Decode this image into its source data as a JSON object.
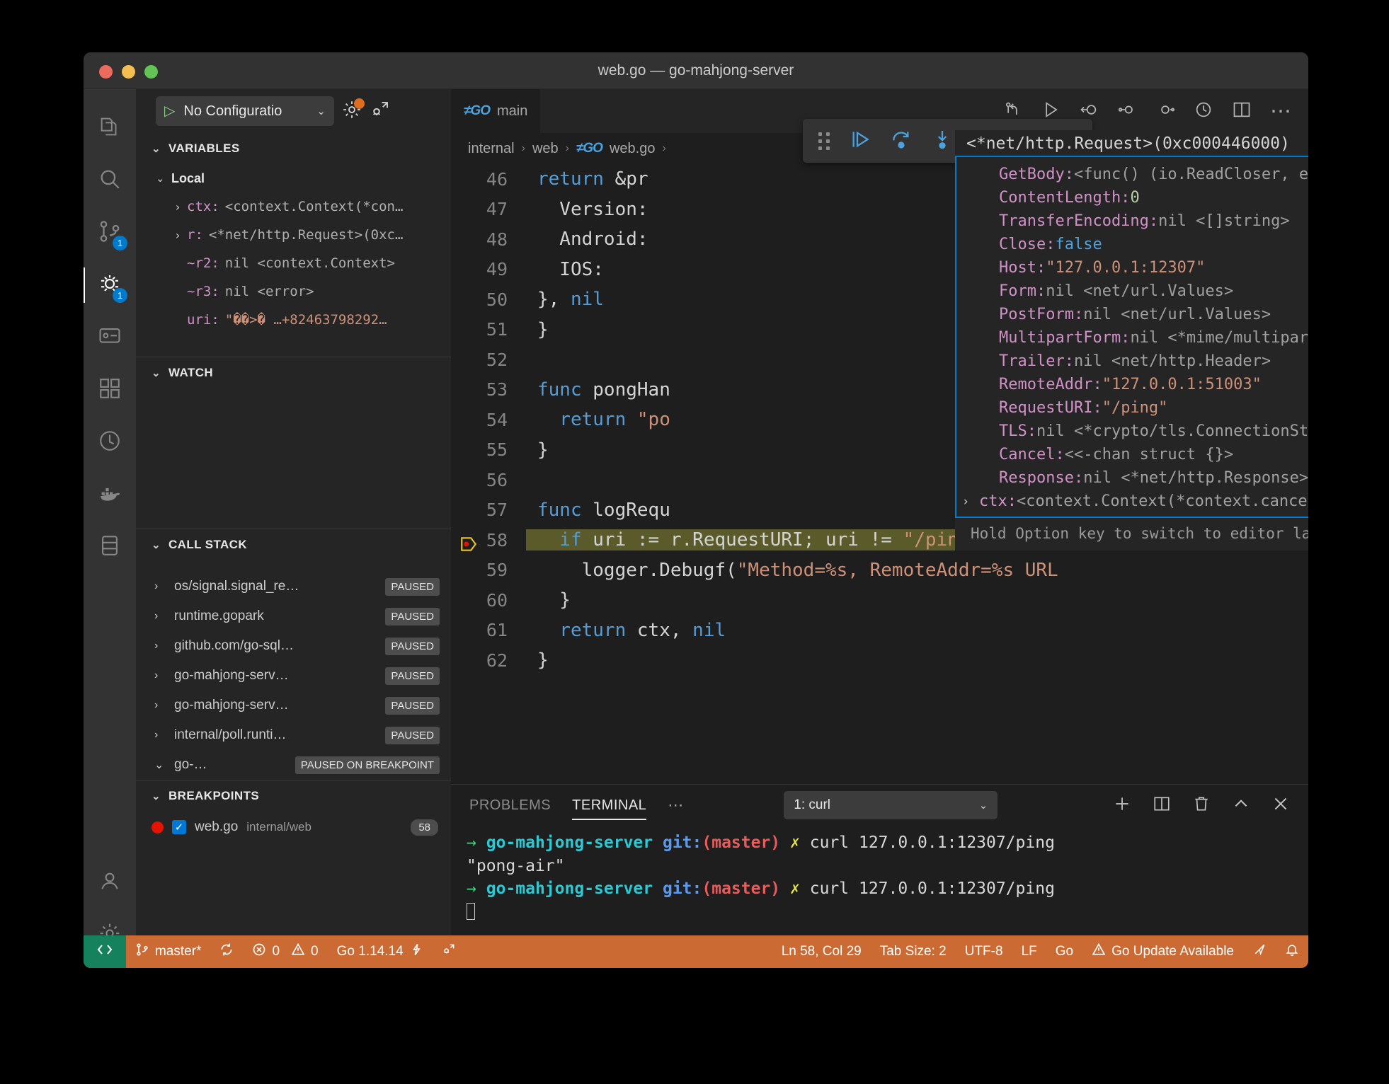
{
  "window": {
    "title": "web.go — go-mahjong-server"
  },
  "activity_bar": {
    "items": [
      {
        "name": "explorer",
        "icon": "files-icon",
        "badge": null
      },
      {
        "name": "search",
        "icon": "search-icon",
        "badge": null
      },
      {
        "name": "source-control",
        "icon": "source-control-icon",
        "badge": "1"
      },
      {
        "name": "run-and-debug",
        "icon": "debug-icon",
        "badge": "1",
        "active": true
      },
      {
        "name": "remote-explorer",
        "icon": "remote-explorer-icon",
        "badge": null
      },
      {
        "name": "extensions",
        "icon": "extensions-icon",
        "badge": null
      },
      {
        "name": "testing",
        "icon": "beaker-icon",
        "badge": null
      },
      {
        "name": "docker",
        "icon": "docker-icon",
        "badge": null
      },
      {
        "name": "database",
        "icon": "database-icon",
        "badge": null
      }
    ],
    "bottom": [
      {
        "name": "accounts",
        "icon": "account-icon"
      },
      {
        "name": "settings",
        "icon": "gear-icon"
      }
    ]
  },
  "debug_sidebar": {
    "config_label": "No Configuratio",
    "config_play_icon": "play-icon",
    "gear_icon": "gear-icon",
    "open_debug_console_icon": "debug-console-icon",
    "variables": {
      "title": "VARIABLES",
      "scope": "Local",
      "rows": [
        {
          "expandable": true,
          "name": "ctx:",
          "value": "<context.Context(*con…"
        },
        {
          "expandable": true,
          "name": "r:",
          "value": "<*net/http.Request>(0xc…"
        },
        {
          "expandable": false,
          "name": "~r2:",
          "value": "nil <context.Context>"
        },
        {
          "expandable": false,
          "name": "~r3:",
          "value": "nil <error>"
        },
        {
          "expandable": false,
          "name": "uri:",
          "value": "\"��>� …+82463798292…",
          "is_string": true
        }
      ]
    },
    "watch": {
      "title": "WATCH"
    },
    "call_stack": {
      "title": "CALL STACK",
      "rows": [
        {
          "name": "os/signal.signal_re…",
          "state": "PAUSED"
        },
        {
          "name": "runtime.gopark",
          "state": "PAUSED"
        },
        {
          "name": "github.com/go-sql…",
          "state": "PAUSED"
        },
        {
          "name": "go-mahjong-serv…",
          "state": "PAUSED"
        },
        {
          "name": "go-mahjong-serv…",
          "state": "PAUSED"
        },
        {
          "name": "internal/poll.runti…",
          "state": "PAUSED"
        },
        {
          "name": "go-…",
          "state": "PAUSED ON BREAKPOINT",
          "expanded": true
        }
      ]
    },
    "breakpoints": {
      "title": "BREAKPOINTS",
      "rows": [
        {
          "file": "web.go",
          "path": "internal/web",
          "line": "58",
          "enabled": true
        }
      ]
    }
  },
  "debug_toolbar": {
    "buttons": [
      {
        "name": "drag-handle",
        "icon": "grip-icon"
      },
      {
        "name": "continue-button",
        "icon": "continue-icon"
      },
      {
        "name": "step-over-button",
        "icon": "step-over-icon"
      },
      {
        "name": "step-into-button",
        "icon": "step-into-icon"
      },
      {
        "name": "step-out-button",
        "icon": "step-out-icon"
      },
      {
        "name": "restart-button",
        "icon": "restart-icon"
      },
      {
        "name": "stop-button",
        "icon": "stop-icon"
      }
    ]
  },
  "editor": {
    "tab": {
      "label": "main",
      "icon": "go-file-icon"
    },
    "actions": [
      {
        "name": "split-editor-down-button",
        "icon": "split-down-icon"
      },
      {
        "name": "run-go-button",
        "icon": "run-icon"
      },
      {
        "name": "debug-test-button",
        "icon": "debug-alt-icon"
      },
      {
        "name": "run-subtest-button",
        "icon": "run-subtest-icon"
      },
      {
        "name": "run-file-button",
        "icon": "run-file-icon"
      },
      {
        "name": "go-test-coverage-button",
        "icon": "coverage-icon"
      },
      {
        "name": "split-editor-right-button",
        "icon": "split-right-icon"
      },
      {
        "name": "more-actions-button",
        "icon": "ellipsis-icon"
      }
    ],
    "breadcrumb": [
      "internal",
      "web",
      "web.go"
    ],
    "breadcrumb_file_icon": "go-file-icon",
    "lines": [
      {
        "n": "46",
        "tokens": [
          {
            "t": "return ",
            "c": "k"
          },
          {
            "t": "&pr",
            "c": "id"
          }
        ]
      },
      {
        "n": "47",
        "tokens": [
          {
            "t": "  Version:",
            "c": "id"
          }
        ]
      },
      {
        "n": "48",
        "tokens": [
          {
            "t": "  Android:",
            "c": "id"
          }
        ]
      },
      {
        "n": "49",
        "tokens": [
          {
            "t": "  IOS:",
            "c": "id"
          }
        ]
      },
      {
        "n": "50",
        "tokens": [
          {
            "t": "}, ",
            "c": "id"
          },
          {
            "t": "nil",
            "c": "k"
          }
        ]
      },
      {
        "n": "51",
        "tokens": [
          {
            "t": "}",
            "c": "id"
          }
        ]
      },
      {
        "n": "52",
        "tokens": []
      },
      {
        "n": "53",
        "tokens": [
          {
            "t": "func ",
            "c": "k"
          },
          {
            "t": "pongHan",
            "c": "id"
          }
        ]
      },
      {
        "n": "54",
        "tokens": [
          {
            "t": "  return ",
            "c": "k"
          },
          {
            "t": "\"po",
            "c": "s"
          }
        ]
      },
      {
        "n": "55",
        "tokens": [
          {
            "t": "}",
            "c": "id"
          }
        ]
      },
      {
        "n": "56",
        "tokens": []
      },
      {
        "n": "57",
        "tokens": [
          {
            "t": "func ",
            "c": "k"
          },
          {
            "t": "logRequ",
            "c": "id"
          }
        ]
      },
      {
        "n": "58",
        "highlight": true,
        "breakpoint": true,
        "tokens": [
          {
            "t": "  if ",
            "c": "k"
          },
          {
            "t": "uri := r.RequestURI; uri != ",
            "c": "id"
          },
          {
            "t": "\"/ping\"",
            "c": "s"
          },
          {
            "t": " {",
            "c": "id"
          }
        ]
      },
      {
        "n": "59",
        "tokens": [
          {
            "t": "    logger.Debugf(",
            "c": "id"
          },
          {
            "t": "\"Method=%s, RemoteAddr=%s URL",
            "c": "s"
          }
        ]
      },
      {
        "n": "60",
        "tokens": [
          {
            "t": "  }",
            "c": "id"
          }
        ]
      },
      {
        "n": "61",
        "tokens": [
          {
            "t": "  return ",
            "c": "k"
          },
          {
            "t": "ctx, ",
            "c": "id"
          },
          {
            "t": "nil",
            "c": "k"
          }
        ]
      },
      {
        "n": "62",
        "tokens": [
          {
            "t": "}",
            "c": "id"
          }
        ]
      }
    ]
  },
  "hover_popup": {
    "header": "<*net/http.Request>(0xc000446000)",
    "rows": [
      {
        "key": "GetBody:",
        "value": " <func() (io.ReadCloser, error)>",
        "kind": "type"
      },
      {
        "key": "ContentLength:",
        "value": " 0",
        "kind": "number"
      },
      {
        "key": "TransferEncoding:",
        "value": " nil <[]string>",
        "kind": "type"
      },
      {
        "key": "Close:",
        "value": " false",
        "kind": "bool"
      },
      {
        "key": "Host:",
        "value": " \"127.0.0.1:12307\"",
        "kind": "string"
      },
      {
        "key": "Form:",
        "value": " nil <net/url.Values>",
        "kind": "type"
      },
      {
        "key": "PostForm:",
        "value": " nil <net/url.Values>",
        "kind": "type"
      },
      {
        "key": "MultipartForm:",
        "value": " nil <*mime/multipart.Form>",
        "kind": "type"
      },
      {
        "key": "Trailer:",
        "value": " nil <net/http.Header>",
        "kind": "type"
      },
      {
        "key": "RemoteAddr:",
        "value": " \"127.0.0.1:51003\"",
        "kind": "string"
      },
      {
        "key": "RequestURI:",
        "value": " \"/ping\"",
        "kind": "string"
      },
      {
        "key": "TLS:",
        "value": " nil <*crypto/tls.ConnectionState>",
        "kind": "type"
      },
      {
        "key": "Cancel:",
        "value": " <<-chan struct {}>",
        "kind": "type"
      },
      {
        "key": "Response:",
        "value": " nil <*net/http.Response>",
        "kind": "type"
      },
      {
        "key": "ctx:",
        "value": " <context.Context(*context.cancelCtx)>)",
        "kind": "type",
        "expandable": true
      }
    ],
    "footer": "Hold Option key to switch to editor language hover"
  },
  "panel": {
    "tabs": [
      {
        "label": "PROBLEMS",
        "active": false
      },
      {
        "label": "TERMINAL",
        "active": true
      }
    ],
    "more_label": "⋯",
    "terminal_select": "1: curl",
    "actions": [
      {
        "name": "new-terminal-button",
        "icon": "plus-icon"
      },
      {
        "name": "split-terminal-button",
        "icon": "split-icon"
      },
      {
        "name": "kill-terminal-button",
        "icon": "trash-icon"
      },
      {
        "name": "maximize-panel-button",
        "icon": "chevron-up-icon"
      },
      {
        "name": "close-panel-button",
        "icon": "close-icon"
      }
    ],
    "terminal_lines": [
      {
        "type": "prompt",
        "repo": "go-mahjong-server",
        "git": "git:",
        "branch": "(master)",
        "x": "✗",
        "cmd": "curl 127.0.0.1:12307/ping"
      },
      {
        "type": "output",
        "text": "\"pong-air\""
      },
      {
        "type": "prompt",
        "repo": "go-mahjong-server",
        "git": "git:",
        "branch": "(master)",
        "x": "✗",
        "cmd": "curl 127.0.0.1:12307/ping"
      },
      {
        "type": "cursor"
      }
    ]
  },
  "status_bar": {
    "remote_icon": "remote-icon",
    "branch": "master*",
    "sync_icon": "sync-icon",
    "errors": "0",
    "warnings": "0",
    "go_version": "Go 1.14.14",
    "debug_icon": "debug-alt-small-icon",
    "cursor_position": "Ln 58, Col 29",
    "tab_size": "Tab Size: 2",
    "encoding": "UTF-8",
    "eol": "LF",
    "language": "Go",
    "update_notice": "Go Update Available",
    "feedback_icon": "feedback-icon",
    "bell_icon": "bell-icon"
  },
  "colors": {
    "accent": "#007acc",
    "status_bar_bg": "#cb6a32",
    "remote_bg": "#16825d",
    "breakpoint_red": "#e51400",
    "highlight_line": "#5a5a2b"
  }
}
